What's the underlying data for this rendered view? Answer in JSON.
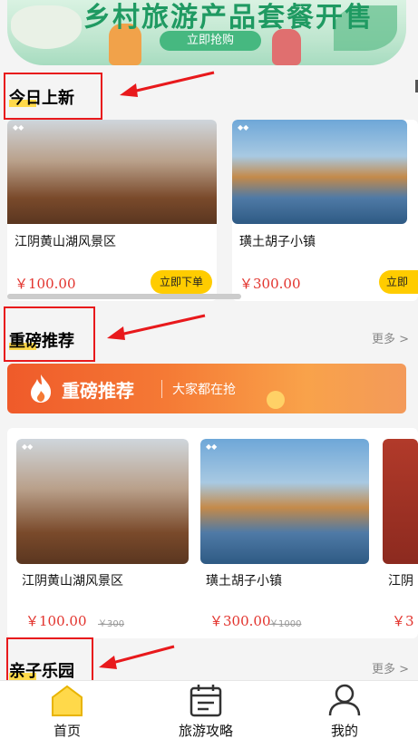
{
  "banner": {
    "title": "乡村旅游产品套餐开售",
    "button": "立即抢购"
  },
  "section_new": {
    "title": "今日上新"
  },
  "section_hot": {
    "title": "重磅推荐",
    "more": "更多 >"
  },
  "section_family": {
    "title": "亲子乐园",
    "more": "更多 >"
  },
  "row1": [
    {
      "name": "江阴黄山湖风景区",
      "price": "￥100.00",
      "button": "立即下单",
      "image": "waterwheel"
    },
    {
      "name": "璜土胡子小镇",
      "price": "￥300.00",
      "button": "立即",
      "image": "lake-pagoda"
    }
  ],
  "promo": {
    "title": "重磅推荐",
    "subtitle": "大家都在抢",
    "icon": "flame-icon"
  },
  "row2": [
    {
      "name": "江阴黄山湖风景区",
      "price": "￥100.00",
      "original": "￥300",
      "image": "waterwheel"
    },
    {
      "name": "璜土胡子小镇",
      "price": "￥300.00",
      "original": "￥1000",
      "image": "lake-pagoda"
    },
    {
      "name": "江阴",
      "price": "￥3",
      "image": "red-gate"
    }
  ],
  "tabbar": [
    {
      "label": "首页",
      "icon": "home-icon",
      "active": true
    },
    {
      "label": "旅游攻略",
      "icon": "calendar-icon",
      "active": false
    },
    {
      "label": "我的",
      "icon": "user-icon",
      "active": false
    }
  ],
  "colors": {
    "accent": "#ffcc00",
    "price": "#e2322c",
    "annotation": "#e8191c",
    "promo": "#ef5a2a"
  }
}
